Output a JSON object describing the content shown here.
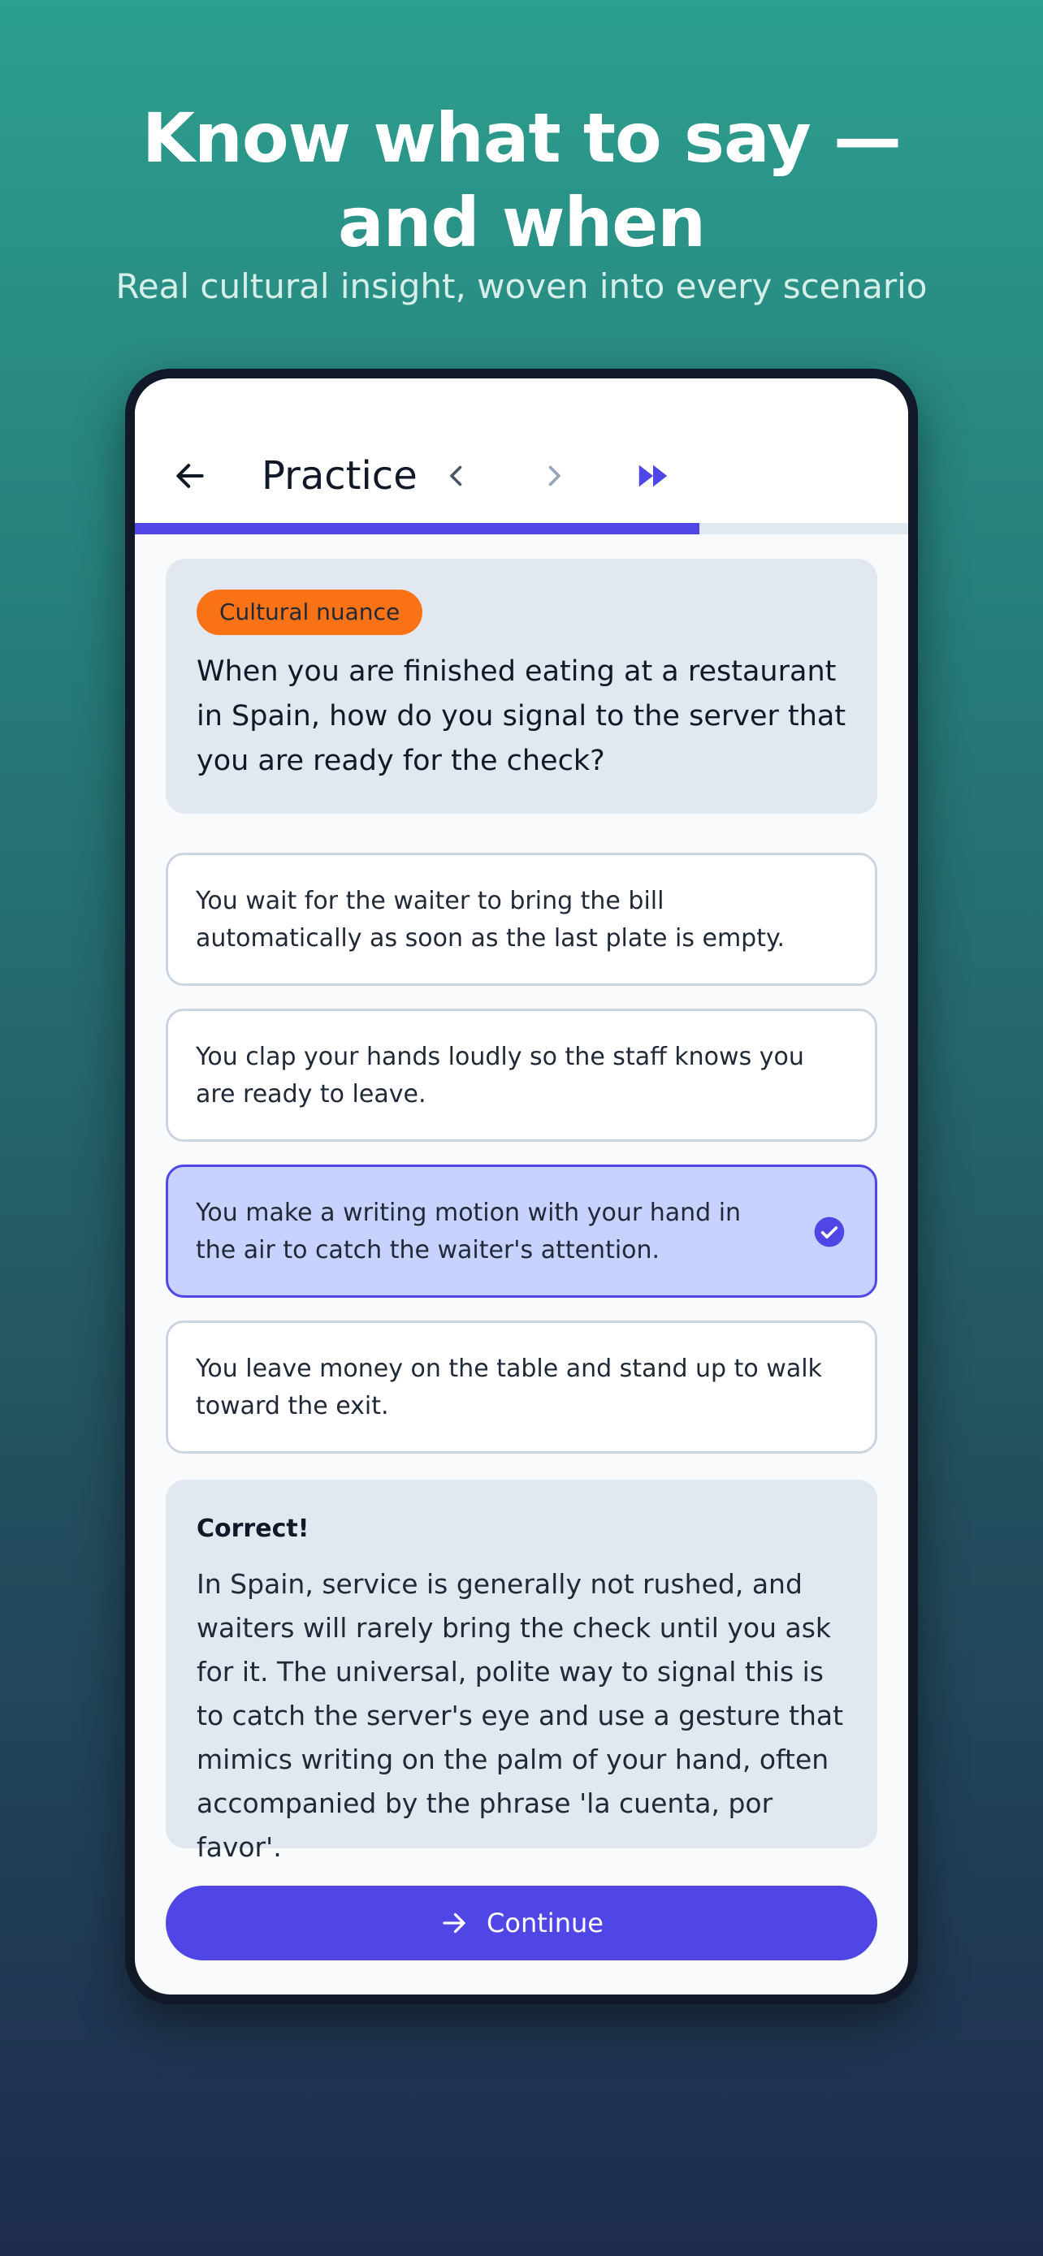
{
  "marketing": {
    "headline_line1": "Know what to say —",
    "headline_line2": "and when",
    "subheadline": "Real cultural insight, woven into every scenario"
  },
  "appbar": {
    "title": "Practice",
    "back_icon": "arrow-left-icon",
    "prev_icon": "chevron-left-icon",
    "next_icon": "chevron-right-icon",
    "skip_icon": "fast-forward-icon"
  },
  "progress": {
    "fraction": 0.73
  },
  "question": {
    "badge": "Cultural nuance",
    "text": "When you are finished eating at a restaurant in Spain, how do you signal to the server that you are ready for the check?"
  },
  "options": [
    {
      "text": "You wait for the waiter to bring the bill automatically as soon as the last plate is empty.",
      "selected": false
    },
    {
      "text": "You clap your hands loudly so the staff knows you are ready to leave.",
      "selected": false
    },
    {
      "text": "You make a writing motion with your hand in the air to catch the waiter's attention.",
      "selected": true
    },
    {
      "text": "You leave money on the table and stand up to walk toward the exit.",
      "selected": false
    }
  ],
  "feedback": {
    "title": "Correct!",
    "text": "In Spain, service is generally not rushed, and waiters will rarely bring the check until you ask for it. The universal, polite way to signal this is to catch the server's eye and use a gesture that mimics writing on the palm of your hand, often accompanied by the phrase 'la cuenta, por favor'."
  },
  "continue_button": {
    "label": "Continue",
    "icon": "arrow-right-icon"
  },
  "colors": {
    "accent": "#4f46e5",
    "badge": "#f97316",
    "selected_bg": "#c7d2fe",
    "card_bg": "#e2e8f0"
  }
}
